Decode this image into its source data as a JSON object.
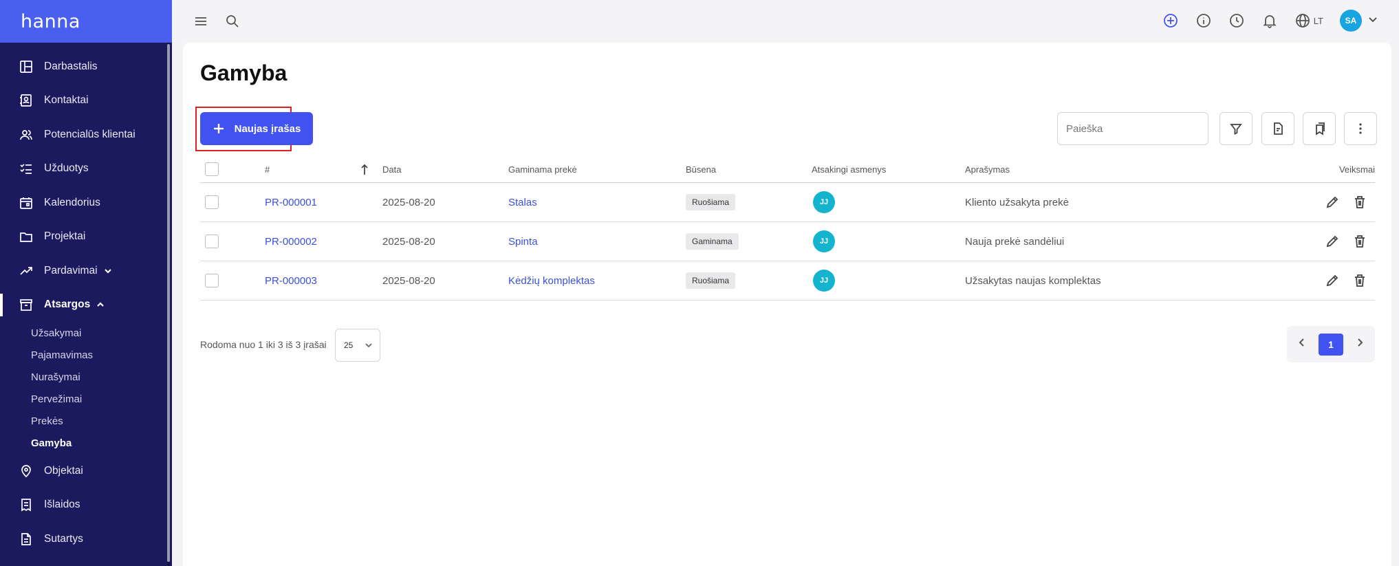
{
  "app": {
    "logo": "hanna"
  },
  "sidebar": {
    "items": [
      {
        "label": "Darbastalis",
        "icon": "dashboard-icon"
      },
      {
        "label": "Kontaktai",
        "icon": "contacts-icon"
      },
      {
        "label": "Potencialūs klientai",
        "icon": "leads-icon"
      },
      {
        "label": "Užduotys",
        "icon": "tasks-icon"
      },
      {
        "label": "Kalendorius",
        "icon": "calendar-icon"
      },
      {
        "label": "Projektai",
        "icon": "folder-icon"
      },
      {
        "label": "Pardavimai",
        "icon": "trend-icon"
      },
      {
        "label": "Atsargos",
        "icon": "archive-icon"
      }
    ],
    "sub_items": [
      "Užsakymai",
      "Pajamavimas",
      "Nurašymai",
      "Pervežimai",
      "Prekės",
      "Gamyba"
    ],
    "items_after": [
      {
        "label": "Objektai",
        "icon": "location-icon"
      },
      {
        "label": "Išlaidos",
        "icon": "receipt-icon"
      },
      {
        "label": "Sutartys",
        "icon": "document-icon"
      }
    ]
  },
  "topbar": {
    "language": "LT",
    "user_initials": "SA"
  },
  "page": {
    "title": "Gamyba",
    "new_button": "Naujas įrašas",
    "search_placeholder": "Paieška"
  },
  "table": {
    "headers": [
      "#",
      "Data",
      "Gaminama prekė",
      "Būsena",
      "Atsakingi asmenys",
      "Aprašymas",
      "Veiksmai"
    ],
    "rows": [
      {
        "id": "PR-000001",
        "date": "2025-08-20",
        "product": "Stalas",
        "status": "Ruošiama",
        "responsible": "JJ",
        "description": "Kliento užsakyta prekė"
      },
      {
        "id": "PR-000002",
        "date": "2025-08-20",
        "product": "Spinta",
        "status": "Gaminama",
        "responsible": "JJ",
        "description": "Nauja prekė sandėliui"
      },
      {
        "id": "PR-000003",
        "date": "2025-08-20",
        "product": "Kėdžių komplektas",
        "status": "Ruošiama",
        "responsible": "JJ",
        "description": "Užsakytas naujas komplektas"
      }
    ]
  },
  "footer": {
    "summary": "Rodoma nuo 1 iki 3 iš 3 įrašai",
    "per_page": "25",
    "current_page": "1"
  },
  "colors": {
    "sidebar": "#1c1a5e",
    "accent": "#4252f0",
    "link": "#3a51d8"
  }
}
